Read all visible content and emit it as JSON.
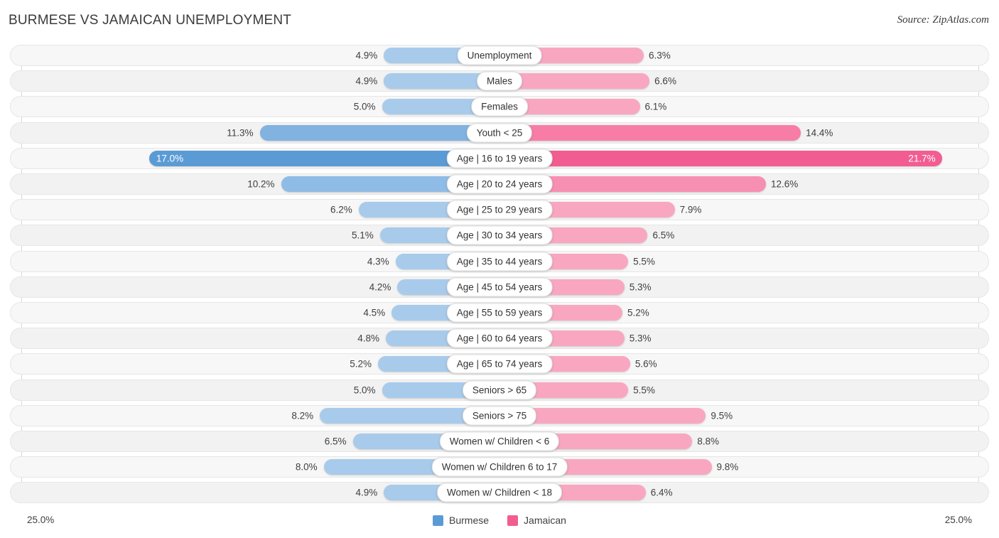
{
  "title": "BURMESE VS JAMAICAN UNEMPLOYMENT",
  "source": "Source: ZipAtlas.com",
  "axis": {
    "left_cap": "25.0%",
    "right_cap": "25.0%"
  },
  "legend": [
    {
      "label": "Burmese",
      "color": "#5b9bd5"
    },
    {
      "label": "Jamaican",
      "color": "#f25d91"
    }
  ],
  "chart_data": {
    "type": "bar",
    "title": "BURMESE VS JAMAICAN UNEMPLOYMENT",
    "subtitle": "Source: ZipAtlas.com",
    "orientation": "horizontal-diverging",
    "xlabel": "",
    "ylabel": "",
    "xlim": [
      -25.0,
      25.0
    ],
    "axis_cap_left": "25.0%",
    "axis_cap_right": "25.0%",
    "grid": false,
    "legend_position": "bottom-center",
    "categories": [
      "Unemployment",
      "Males",
      "Females",
      "Youth < 25",
      "Age | 16 to 19 years",
      "Age | 20 to 24 years",
      "Age | 25 to 29 years",
      "Age | 30 to 34 years",
      "Age | 35 to 44 years",
      "Age | 45 to 54 years",
      "Age | 55 to 59 years",
      "Age | 60 to 64 years",
      "Age | 65 to 74 years",
      "Seniors > 65",
      "Seniors > 75",
      "Women w/ Children < 6",
      "Women w/ Children 6 to 17",
      "Women w/ Children < 18"
    ],
    "series": [
      {
        "name": "Burmese",
        "color": "#5b9bd5",
        "side": "left",
        "values": [
          4.9,
          4.9,
          5.0,
          11.3,
          17.0,
          10.2,
          6.2,
          5.1,
          4.3,
          4.2,
          4.5,
          4.8,
          5.2,
          5.0,
          8.2,
          6.5,
          8.0,
          4.9
        ],
        "labels": [
          "4.9%",
          "4.9%",
          "5.0%",
          "11.3%",
          "17.0%",
          "10.2%",
          "6.2%",
          "5.1%",
          "4.3%",
          "4.2%",
          "4.5%",
          "4.8%",
          "5.2%",
          "5.0%",
          "8.2%",
          "6.5%",
          "8.0%",
          "4.9%"
        ]
      },
      {
        "name": "Jamaican",
        "color": "#f25d91",
        "side": "right",
        "values": [
          6.3,
          6.6,
          6.1,
          14.4,
          21.7,
          12.6,
          7.9,
          6.5,
          5.5,
          5.3,
          5.2,
          5.3,
          5.6,
          5.5,
          9.5,
          8.8,
          9.8,
          6.4
        ],
        "labels": [
          "6.3%",
          "6.6%",
          "6.1%",
          "14.4%",
          "21.7%",
          "12.6%",
          "7.9%",
          "6.5%",
          "5.5%",
          "5.3%",
          "5.2%",
          "5.3%",
          "5.6%",
          "5.5%",
          "9.5%",
          "8.8%",
          "9.8%",
          "6.4%"
        ]
      }
    ]
  }
}
